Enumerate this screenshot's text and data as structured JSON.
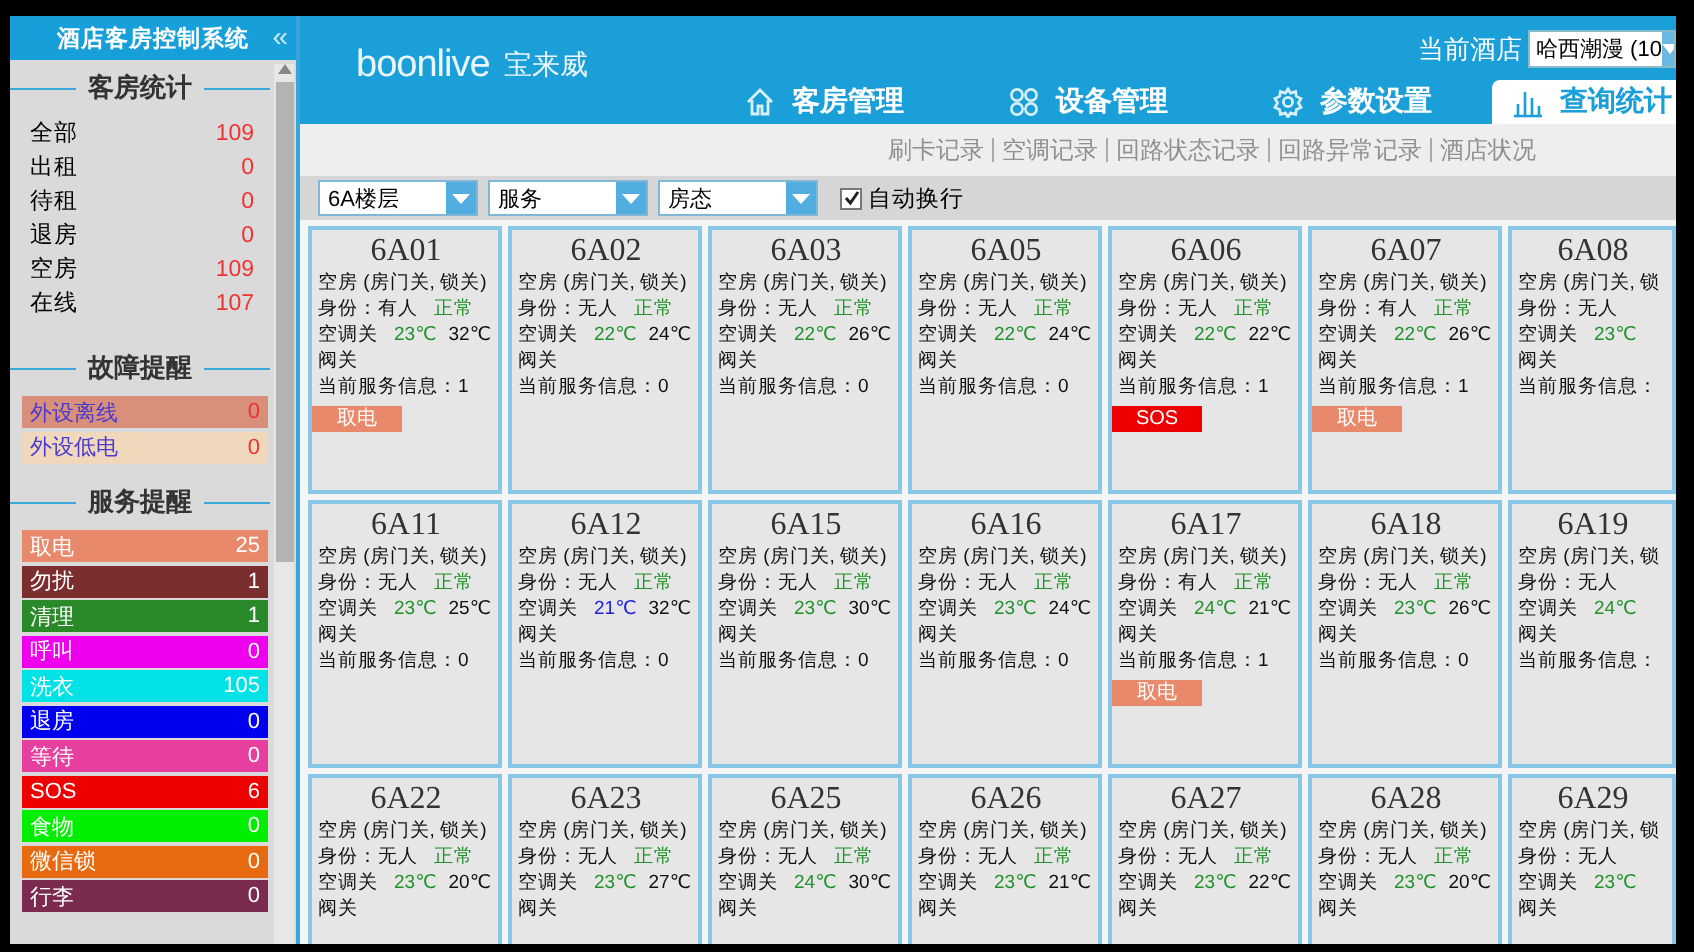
{
  "sidebar": {
    "title": "酒店客房控制系统",
    "collapse_icon": "«",
    "room_stats": {
      "heading": "客房统计",
      "items": [
        {
          "label": "全部",
          "value": "109"
        },
        {
          "label": "出租",
          "value": "0"
        },
        {
          "label": "待租",
          "value": "0"
        },
        {
          "label": "退房",
          "value": "0"
        },
        {
          "label": "空房",
          "value": "109"
        },
        {
          "label": "在线",
          "value": "107"
        }
      ]
    },
    "fault_alerts": {
      "heading": "故障提醒",
      "items": [
        {
          "label": "外设离线",
          "value": "0",
          "color": "#d9907a"
        },
        {
          "label": "外设低电",
          "value": "0",
          "color": "#f0d8bc"
        }
      ]
    },
    "service_alerts": {
      "heading": "服务提醒",
      "items": [
        {
          "label": "取电",
          "value": "25",
          "color": "#e8896b"
        },
        {
          "label": "勿扰",
          "value": "1",
          "color": "#7b2e2e"
        },
        {
          "label": "清理",
          "value": "1",
          "color": "#2a8a2a"
        },
        {
          "label": "呼叫",
          "value": "0",
          "color": "#ee00ee"
        },
        {
          "label": "洗衣",
          "value": "105",
          "color": "#00e2e6"
        },
        {
          "label": "退房",
          "value": "0",
          "color": "#0000ee"
        },
        {
          "label": "等待",
          "value": "0",
          "color": "#e63fa0"
        },
        {
          "label": "SOS",
          "value": "6",
          "color": "#ee0000"
        },
        {
          "label": "食物",
          "value": "0",
          "color": "#00ee00"
        },
        {
          "label": "微信锁",
          "value": "0",
          "color": "#e86a10"
        },
        {
          "label": "行李",
          "value": "0",
          "color": "#7b2a50"
        }
      ]
    }
  },
  "header": {
    "logo": "boonlive",
    "logo_cn": "宝来威",
    "hotel_label": "当前酒店",
    "hotel_select": "哈西潮漫 (10",
    "tabs": [
      {
        "label": "客房管理",
        "selected": false
      },
      {
        "label": "设备管理",
        "selected": false
      },
      {
        "label": "参数设置",
        "selected": false
      },
      {
        "label": "查询统计",
        "selected": true
      }
    ]
  },
  "sub_links": [
    "刷卡记录",
    "空调记录",
    "回路状态记录",
    "回路异常记录",
    "酒店状况"
  ],
  "filters": {
    "selects": [
      "6A楼层",
      "服务",
      "房态"
    ],
    "auto_wrap": {
      "label": "自动换行",
      "checked": true
    }
  },
  "rooms": [
    {
      "id": "6A01",
      "state": "空房 (房门关, 锁关)",
      "identity": "身份：有人",
      "health": "正常",
      "ac": "空调关",
      "set_temp": {
        "text": "23℃",
        "color": "#22922a"
      },
      "room_temp": "32℃",
      "valve": "阀关",
      "service": "当前服务信息：1",
      "tag": {
        "label": "取电",
        "color": "#e8896b"
      }
    },
    {
      "id": "6A02",
      "state": "空房 (房门关, 锁关)",
      "identity": "身份：无人",
      "health": "正常",
      "ac": "空调关",
      "set_temp": {
        "text": "22℃",
        "color": "#22922a"
      },
      "room_temp": "24℃",
      "valve": "阀关",
      "service": "当前服务信息：0"
    },
    {
      "id": "6A03",
      "state": "空房 (房门关, 锁关)",
      "identity": "身份：无人",
      "health": "正常",
      "ac": "空调关",
      "set_temp": {
        "text": "22℃",
        "color": "#22922a"
      },
      "room_temp": "26℃",
      "valve": "阀关",
      "service": "当前服务信息：0"
    },
    {
      "id": "6A05",
      "state": "空房 (房门关, 锁关)",
      "identity": "身份：无人",
      "health": "正常",
      "ac": "空调关",
      "set_temp": {
        "text": "22℃",
        "color": "#22922a"
      },
      "room_temp": "24℃",
      "valve": "阀关",
      "service": "当前服务信息：0"
    },
    {
      "id": "6A06",
      "state": "空房 (房门关, 锁关)",
      "identity": "身份：无人",
      "health": "正常",
      "ac": "空调关",
      "set_temp": {
        "text": "22℃",
        "color": "#22922a"
      },
      "room_temp": "22℃",
      "valve": "阀关",
      "service": "当前服务信息：1",
      "tag": {
        "label": "SOS",
        "color": "#ee0000"
      }
    },
    {
      "id": "6A07",
      "state": "空房 (房门关, 锁关)",
      "identity": "身份：有人",
      "health": "正常",
      "ac": "空调关",
      "set_temp": {
        "text": "22℃",
        "color": "#22922a"
      },
      "room_temp": "26℃",
      "valve": "阀关",
      "service": "当前服务信息：1",
      "tag": {
        "label": "取电",
        "color": "#e8896b"
      }
    },
    {
      "id": "6A08",
      "state": "空房 (房门关, 锁",
      "identity": "身份：无人",
      "ac": "空调关",
      "set_temp": {
        "text": "23℃",
        "color": "#22922a"
      },
      "valve": "阀关",
      "service": "当前服务信息："
    },
    {
      "id": "6A11",
      "state": "空房 (房门关, 锁关)",
      "identity": "身份：无人",
      "health": "正常",
      "ac": "空调关",
      "set_temp": {
        "text": "23℃",
        "color": "#22922a"
      },
      "room_temp": "25℃",
      "valve": "阀关",
      "service": "当前服务信息：0"
    },
    {
      "id": "6A12",
      "state": "空房 (房门关, 锁关)",
      "identity": "身份：无人",
      "health": "正常",
      "ac": "空调关",
      "set_temp": {
        "text": "21℃",
        "color": "#2020e0"
      },
      "room_temp": "32℃",
      "valve": "阀关",
      "service": "当前服务信息：0"
    },
    {
      "id": "6A15",
      "state": "空房 (房门关, 锁关)",
      "identity": "身份：无人",
      "health": "正常",
      "ac": "空调关",
      "set_temp": {
        "text": "23℃",
        "color": "#22922a"
      },
      "room_temp": "30℃",
      "valve": "阀关",
      "service": "当前服务信息：0"
    },
    {
      "id": "6A16",
      "state": "空房 (房门关, 锁关)",
      "identity": "身份：无人",
      "health": "正常",
      "ac": "空调关",
      "set_temp": {
        "text": "23℃",
        "color": "#22922a"
      },
      "room_temp": "24℃",
      "valve": "阀关",
      "service": "当前服务信息：0"
    },
    {
      "id": "6A17",
      "state": "空房 (房门关, 锁关)",
      "identity": "身份：有人",
      "health": "正常",
      "ac": "空调关",
      "set_temp": {
        "text": "24℃",
        "color": "#22922a"
      },
      "room_temp": "21℃",
      "valve": "阀关",
      "service": "当前服务信息：1",
      "tag": {
        "label": "取电",
        "color": "#e8896b"
      }
    },
    {
      "id": "6A18",
      "state": "空房 (房门关, 锁关)",
      "identity": "身份：无人",
      "health": "正常",
      "ac": "空调关",
      "set_temp": {
        "text": "23℃",
        "color": "#22922a"
      },
      "room_temp": "26℃",
      "valve": "阀关",
      "service": "当前服务信息：0"
    },
    {
      "id": "6A19",
      "state": "空房 (房门关, 锁",
      "identity": "身份：无人",
      "ac": "空调关",
      "set_temp": {
        "text": "24℃",
        "color": "#22922a"
      },
      "valve": "阀关",
      "service": "当前服务信息："
    },
    {
      "id": "6A22",
      "state": "空房 (房门关, 锁关)",
      "identity": "身份：无人",
      "health": "正常",
      "ac": "空调关",
      "set_temp": {
        "text": "23℃",
        "color": "#22922a"
      },
      "room_temp": "20℃",
      "valve": "阀关"
    },
    {
      "id": "6A23",
      "state": "空房 (房门关, 锁关)",
      "identity": "身份：无人",
      "health": "正常",
      "ac": "空调关",
      "set_temp": {
        "text": "23℃",
        "color": "#22922a"
      },
      "room_temp": "27℃",
      "valve": "阀关"
    },
    {
      "id": "6A25",
      "state": "空房 (房门关, 锁关)",
      "identity": "身份：无人",
      "health": "正常",
      "ac": "空调关",
      "set_temp": {
        "text": "24℃",
        "color": "#22922a"
      },
      "room_temp": "30℃",
      "valve": "阀关"
    },
    {
      "id": "6A26",
      "state": "空房 (房门关, 锁关)",
      "identity": "身份：无人",
      "health": "正常",
      "ac": "空调关",
      "set_temp": {
        "text": "23℃",
        "color": "#22922a"
      },
      "room_temp": "21℃",
      "valve": "阀关"
    },
    {
      "id": "6A27",
      "state": "空房 (房门关, 锁关)",
      "identity": "身份：无人",
      "health": "正常",
      "ac": "空调关",
      "set_temp": {
        "text": "23℃",
        "color": "#22922a"
      },
      "room_temp": "22℃",
      "valve": "阀关"
    },
    {
      "id": "6A28",
      "state": "空房 (房门关, 锁关)",
      "identity": "身份：无人",
      "health": "正常",
      "ac": "空调关",
      "set_temp": {
        "text": "23℃",
        "color": "#22922a"
      },
      "room_temp": "20℃",
      "valve": "阀关"
    },
    {
      "id": "6A29",
      "state": "空房 (房门关, 锁",
      "identity": "身份：无人",
      "ac": "空调关",
      "set_temp": {
        "text": "23℃",
        "color": "#22922a"
      },
      "valve": "阀关"
    }
  ]
}
